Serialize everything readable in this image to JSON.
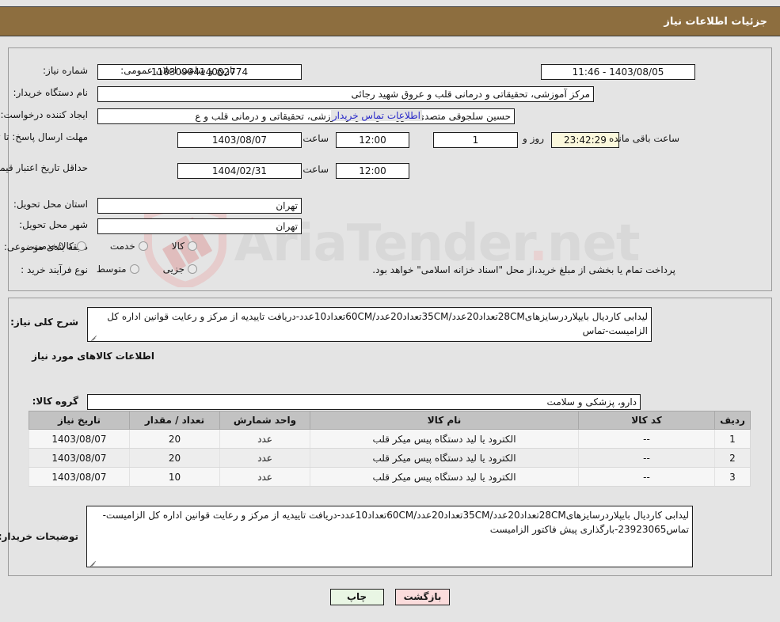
{
  "header": {
    "title": "جزئیات اطلاعات نیاز"
  },
  "info": {
    "need_number_label": "شماره نیاز:",
    "need_number_value": "1103099414002774",
    "announce_datetime_label": "تاریخ و ساعت اعلان عمومی:",
    "announce_datetime_value": "1403/08/05 - 11:46",
    "buyer_org_label": "نام دستگاه خریدار:",
    "buyer_org_value": "مرکز آموزشی، تحقیقاتی و درمانی قلب و عروق شهید رجائی",
    "creator_label": "ایجاد کننده درخواست:",
    "creator_value": "حسین سلجوقی متصدی امور دفتری مرکز آموزشی، تحقیقاتی و درمانی قلب و ع",
    "contact_link": "اطلاعات تماس خریدار",
    "reply_deadline_label": "مهلت ارسال پاسخ: تا تاریخ:",
    "reply_deadline_date": "1403/08/07",
    "hour_label": "ساعت",
    "reply_deadline_time": "12:00",
    "remaining_days": "1",
    "days_and_label": "روز و",
    "remaining_time": "23:42:29",
    "remaining_suffix": "ساعت باقی مانده",
    "price_validity_label": "حداقل تاریخ اعتبار قیمت: تا تاریخ:",
    "price_validity_date": "1404/02/31",
    "price_validity_time": "12:00",
    "province_label": "استان محل تحویل:",
    "province_value": "تهران",
    "city_label": "شهر محل تحویل:",
    "city_value": "تهران",
    "category_label": "طبقه بندی موضوعی:",
    "category_options": [
      "کالا",
      "خدمت",
      "کالا/خدمت"
    ],
    "category_selected": "",
    "process_type_label": "نوع فرآیند خرید :",
    "process_options": [
      "جزیی",
      "متوسط"
    ],
    "process_selected": "",
    "payment_note": "پرداخت تمام یا بخشی از مبلغ خرید،از محل \"اسناد خزانه اسلامی\" خواهد بود."
  },
  "need_summary": {
    "label": "شرح کلی نیاز:",
    "value": "لیدابی کاردیال بایپلاردرسایزهای28CMتعداد20عدد/35CMتعداد20عدد/60CMتعداد10عدد-دریافت تاییدیه از مرکز و رعایت قوانین اداره کل الزامیست-تماس"
  },
  "items_section": {
    "heading": "اطلاعات کالاهای مورد نیاز",
    "group_label": "گروه کالا:",
    "group_value": "دارو، پزشکی و سلامت",
    "columns": [
      "ردیف",
      "کد کالا",
      "نام کالا",
      "واحد شمارش",
      "تعداد / مقدار",
      "تاریخ نیاز"
    ],
    "rows": [
      {
        "index": "1",
        "code": "--",
        "name": "الکترود یا لید دستگاه پیس میکر قلب",
        "unit": "عدد",
        "quantity": "20",
        "need_date": "1403/08/07"
      },
      {
        "index": "2",
        "code": "--",
        "name": "الکترود یا لید دستگاه پیس میکر قلب",
        "unit": "عدد",
        "quantity": "20",
        "need_date": "1403/08/07"
      },
      {
        "index": "3",
        "code": "--",
        "name": "الکترود یا لید دستگاه پیس میکر قلب",
        "unit": "عدد",
        "quantity": "10",
        "need_date": "1403/08/07"
      }
    ]
  },
  "buyer_notes": {
    "label": "توضیحات خریدار:",
    "value": "لیدابی کاردیال بایپلاردرسایزهای28CMتعداد20عدد/35CMتعداد20عدد/60CMتعداد10عدد-دریافت تاییدیه از مرکز و رعایت قوانین اداره کل الزامیست-تماس23923065-بارگذاری پیش فاکتور الزامیست"
  },
  "footer": {
    "print_label": "چاپ",
    "back_label": "بازگشت"
  },
  "watermark": {
    "text_aria": "Aria",
    "text_tender": "Tender",
    "text_dot": ".",
    "text_net": "net"
  },
  "colors": {
    "header_bar": "#8d6e3f",
    "page_bg": "#e4e4e4",
    "link": "#2727c8",
    "countdown_bg": "#fbf8dc",
    "print_btn": "#e9f6e4",
    "back_btn": "#fbdcdc",
    "table_header": "#c2c2c2"
  }
}
